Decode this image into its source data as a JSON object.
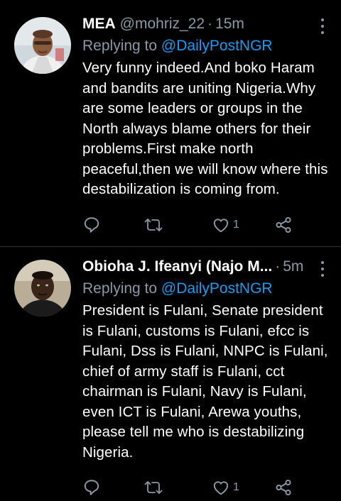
{
  "tweets": [
    {
      "name": "MEA",
      "handle": "@mohriz_22",
      "separator": "·",
      "time": "15m",
      "replying_label": "Replying to",
      "replying_to": "@DailyPostNGR",
      "text": "Very funny indeed.And boko Haram and bandits are uniting Nigeria.Why are some leaders or groups in the North always blame others for their problems.First make north peaceful,then we will know where this destabilization is coming from.",
      "like_count": "1",
      "icons": [
        "reply-icon",
        "retweet-icon",
        "like-icon",
        "share-icon",
        "more-icon"
      ]
    },
    {
      "name": "Obioha J. Ifeanyi (Najo M...",
      "separator": "·",
      "time": "5m",
      "replying_label": "Replying to",
      "replying_to": "@DailyPostNGR",
      "text": "President is Fulani, Senate president is Fulani, customs is Fulani, efcc is Fulani, Dss is Fulani, NNPC is Fulani, chief of army staff is Fulani, cct chairman is Fulani, Navy is Fulani, even ICT is Fulani, Arewa youths, please tell me who is destabilizing Nigeria.",
      "like_count": "1",
      "icons": [
        "reply-icon",
        "retweet-icon",
        "like-icon",
        "share-icon",
        "more-icon"
      ]
    }
  ],
  "colors": {
    "background": "#000000",
    "text": "#ffffff",
    "secondary": "#8b98a5",
    "link": "#1d9bf0",
    "divider": "#2f3336"
  }
}
